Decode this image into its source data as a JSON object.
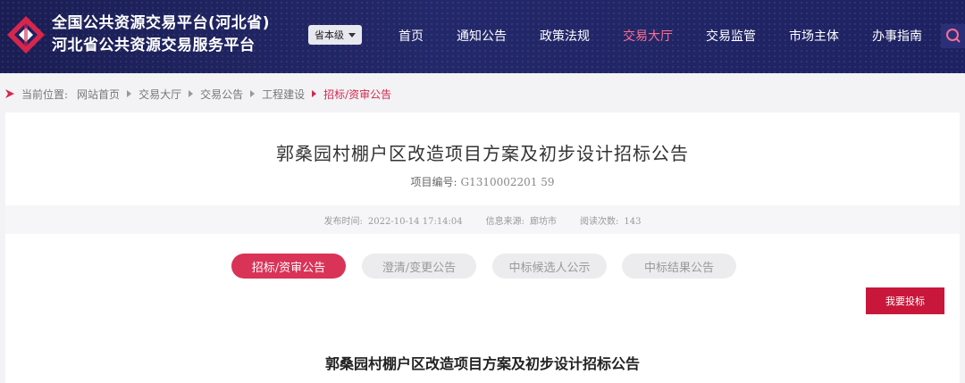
{
  "header": {
    "title_line1": "全国公共资源交易平台(河北省)",
    "title_line2": "河北省公共资源交易服务平台",
    "level_select": "省本级",
    "nav": [
      {
        "label": "首页",
        "active": false
      },
      {
        "label": "通知公告",
        "active": false
      },
      {
        "label": "政策法规",
        "active": false
      },
      {
        "label": "交易大厅",
        "active": true
      },
      {
        "label": "交易监管",
        "active": false
      },
      {
        "label": "市场主体",
        "active": false
      },
      {
        "label": "办事指南",
        "active": false
      }
    ],
    "search_icon": "search-icon",
    "brand_color": "#1e2262",
    "active_color": "#ff6e8e"
  },
  "breadcrumb": {
    "prefix": "当前位置:",
    "items": [
      "网站首页",
      "交易大厅",
      "交易公告",
      "工程建设",
      "招标/资审公告"
    ]
  },
  "article": {
    "title": "郭桑园村棚户区改造项目方案及初步设计招标公告",
    "project_no_label": "项目编号:",
    "project_no": "G1310002201 59",
    "meta": {
      "publish_label": "发布时间:",
      "publish_time": "2022-10-14 17:14:04",
      "source_label": "信息来源:",
      "source": "廊坊市",
      "views_label": "阅读次数:",
      "views": "143"
    },
    "tabs": [
      {
        "label": "招标/资审公告",
        "active": true
      },
      {
        "label": "澄清/变更公告",
        "active": false
      },
      {
        "label": "中标候选人公示",
        "active": false
      },
      {
        "label": "中标结果公告",
        "active": false
      }
    ],
    "bid_button": "我要投标",
    "doc_title": "郭桑园村棚户区改造项目方案及初步设计招标公告",
    "accent_color": "#c9173b"
  }
}
